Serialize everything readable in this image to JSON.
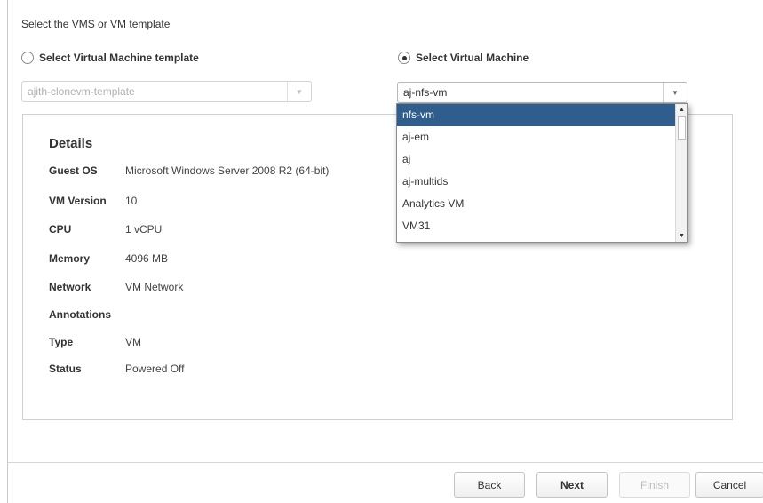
{
  "instruction": "Select the VMS or VM template",
  "template_option": {
    "label": "Select Virtual Machine template",
    "checked": false,
    "combo_value": "ajith-clonevm-template"
  },
  "vm_option": {
    "label": "Select Virtual Machine",
    "checked": true,
    "combo_value": "aj-nfs-vm"
  },
  "dropdown": {
    "items": [
      "nfs-vm",
      "aj-em",
      "aj",
      "aj-multids",
      "Analytics VM",
      "VM31"
    ],
    "selected": "nfs-vm"
  },
  "details": {
    "title": "Details",
    "rows": [
      {
        "label": "Guest OS",
        "value": "Microsoft Windows Server 2008 R2 (64-bit)"
      },
      {
        "label": "VM Version",
        "value": "10"
      },
      {
        "label": "CPU",
        "value": "1 vCPU"
      },
      {
        "label": "Memory",
        "value": "4096 MB"
      },
      {
        "label": "Network",
        "value": "VM Network"
      },
      {
        "label": "Annotations",
        "value": ""
      },
      {
        "label": "Type",
        "value": "VM"
      },
      {
        "label": "Status",
        "value": "Powered Off"
      }
    ]
  },
  "buttons": {
    "back": "Back",
    "next": "Next",
    "finish": "Finish",
    "cancel": "Cancel"
  },
  "colors": {
    "selected_item_bg": "#2e5d8e"
  }
}
